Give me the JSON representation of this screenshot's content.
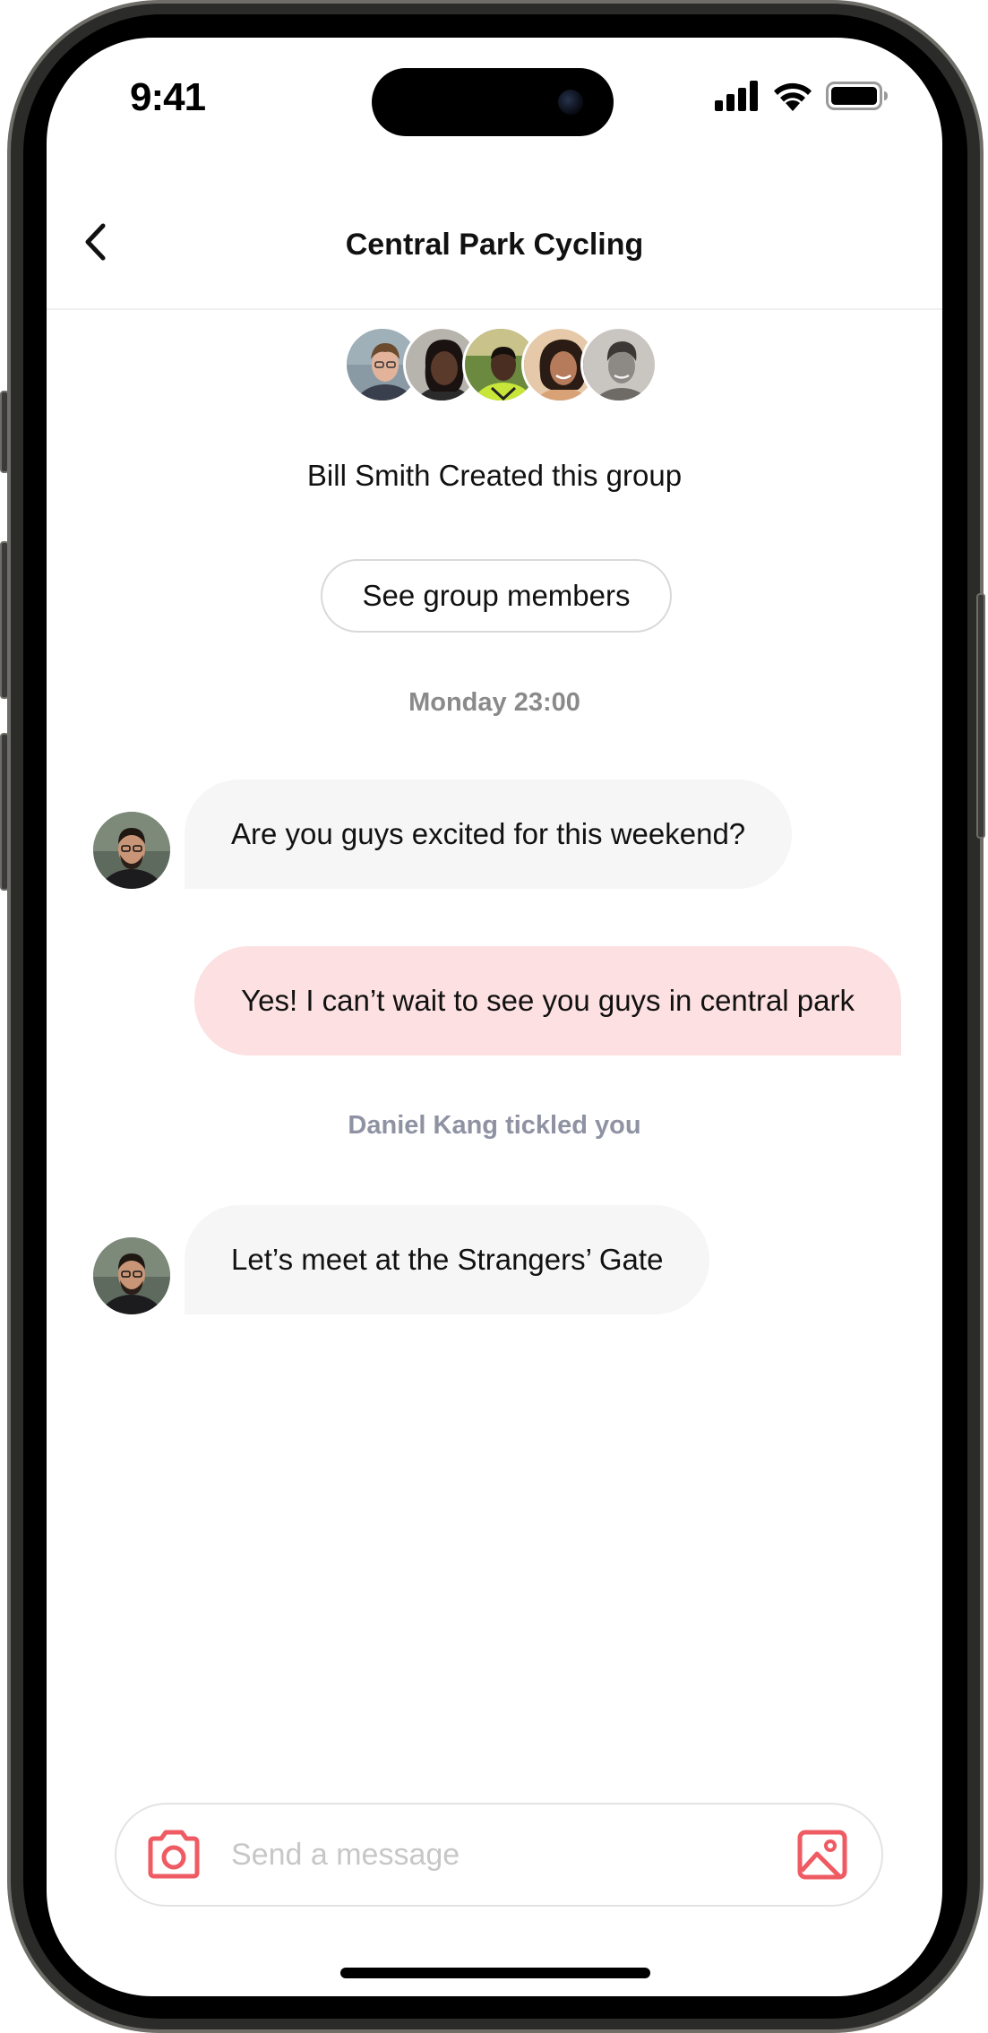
{
  "status_bar": {
    "time": "9:41"
  },
  "nav": {
    "back_icon": "chevron-left-icon",
    "title": "Central Park Cycling"
  },
  "group": {
    "member_avatars": [
      {
        "name": "member-avatar-1",
        "skin": "#e2b39a",
        "hair": "#6b4a2e",
        "shirt": "#3a3f4d",
        "bg": "#8a9aa5"
      },
      {
        "name": "member-avatar-2",
        "skin": "#5a3a2a",
        "hair": "#1a1210",
        "shirt": "#2b2b2b",
        "bg": "#b7b3ad"
      },
      {
        "name": "member-avatar-3",
        "skin": "#4a2e22",
        "hair": "#16100c",
        "shirt": "#c8e63a",
        "bg": "#6b8a3f"
      },
      {
        "name": "member-avatar-4",
        "skin": "#b57b5a",
        "hair": "#2a1c14",
        "shirt": "#d8a276",
        "bg": "#e6c9a8"
      },
      {
        "name": "member-avatar-5",
        "skin": "#8d8a86",
        "hair": "#3b3936",
        "shirt": "#6e6b67",
        "bg": "#c9c6c1"
      }
    ],
    "created_text": "Bill Smith Created this group",
    "members_button": "See group members"
  },
  "conversation": {
    "timestamp": "Monday 23:00",
    "messages": [
      {
        "direction": "incoming",
        "text": "Are you guys excited for this weekend?"
      },
      {
        "direction": "outgoing",
        "text": "Yes! I can’t wait to see you guys in central park"
      },
      {
        "direction": "incoming",
        "text": "Let’s meet at the Strangers’ Gate"
      }
    ],
    "system_note": "Daniel Kang tickled you"
  },
  "composer": {
    "camera_icon": "camera-icon",
    "placeholder": "Send a message",
    "value": "",
    "image_icon": "image-icon"
  },
  "colors": {
    "accent": "#ef5b62",
    "incoming_bubble": "#f6f6f6",
    "outgoing_bubble": "#fde0e1",
    "timestamp": "#8a8a8a",
    "system_note": "#8e92a2"
  }
}
